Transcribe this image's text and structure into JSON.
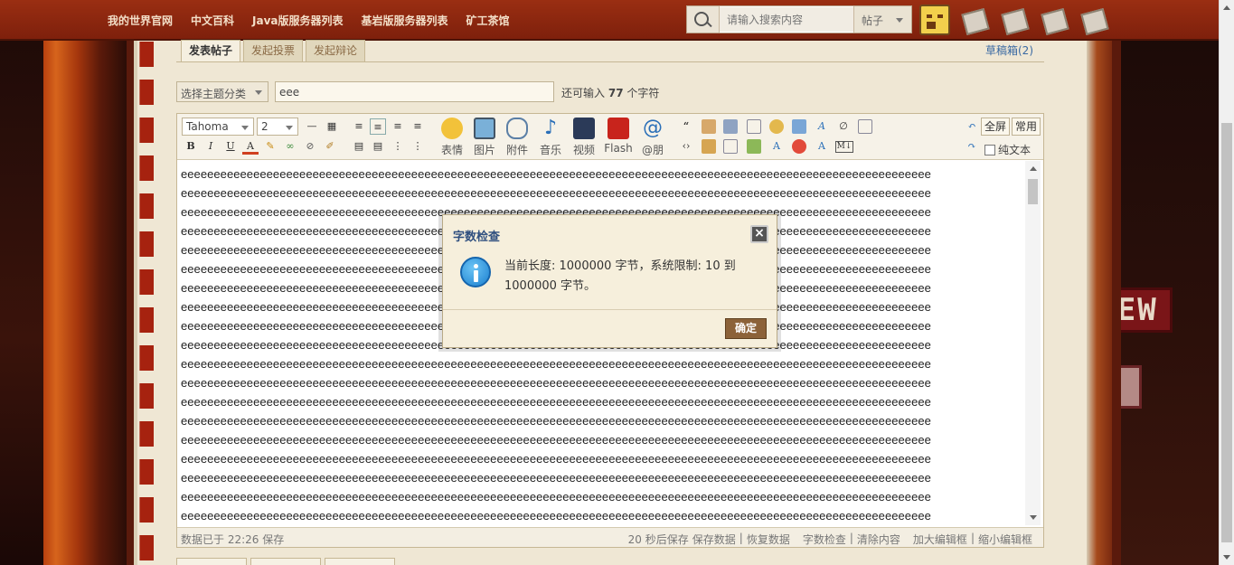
{
  "nav": {
    "links": [
      "我的世界官网",
      "中文百科",
      "Java版服务器列表",
      "基岩版服务器列表",
      "矿工茶馆"
    ],
    "search_placeholder": "请输入搜索内容",
    "search_type": "帖子"
  },
  "tabs": [
    "发表帖子",
    "发起投票",
    "发起辩论"
  ],
  "draft_link": "草稿箱(2)",
  "subject": {
    "category_placeholder": "选择主题分类",
    "title_value": "eee",
    "remaining_prefix": "还可输入",
    "remaining_count": "77",
    "remaining_suffix": "个字符"
  },
  "toolbar": {
    "font_family": "Tahoma",
    "font_size": "2",
    "big_buttons": [
      "表情",
      "图片",
      "附件",
      "音乐",
      "视频",
      "Flash",
      "@朋"
    ],
    "fullscreen": "全屏",
    "common": "常用",
    "plain_text": "纯文本"
  },
  "editor": {
    "content_line": "eeeeeeeeeeeeeeeeeeeeeeeeeeeeeeeeeeeeeeeeeeeeeeeeeeeeeeeeeeeeeeeeeeeeeeeeeeeeeeeeeeeeeeeeeeeeeeeeeeeeeeeeeeeeeeeeee"
  },
  "statusbar": {
    "saved": "数据已于 22:26 保存",
    "actions": [
      "20 秒后保存",
      "保存数据",
      "|",
      "恢复数据",
      "字数检查",
      "|",
      "清除内容",
      "加大编辑框",
      "|",
      "缩小编辑框"
    ]
  },
  "dialog": {
    "title": "字数检查",
    "message": "当前长度: 1000000 字节，系统限制: 10 到 1000000 字节。",
    "ok": "确定"
  },
  "side": {
    "new_badge": "NEW"
  }
}
